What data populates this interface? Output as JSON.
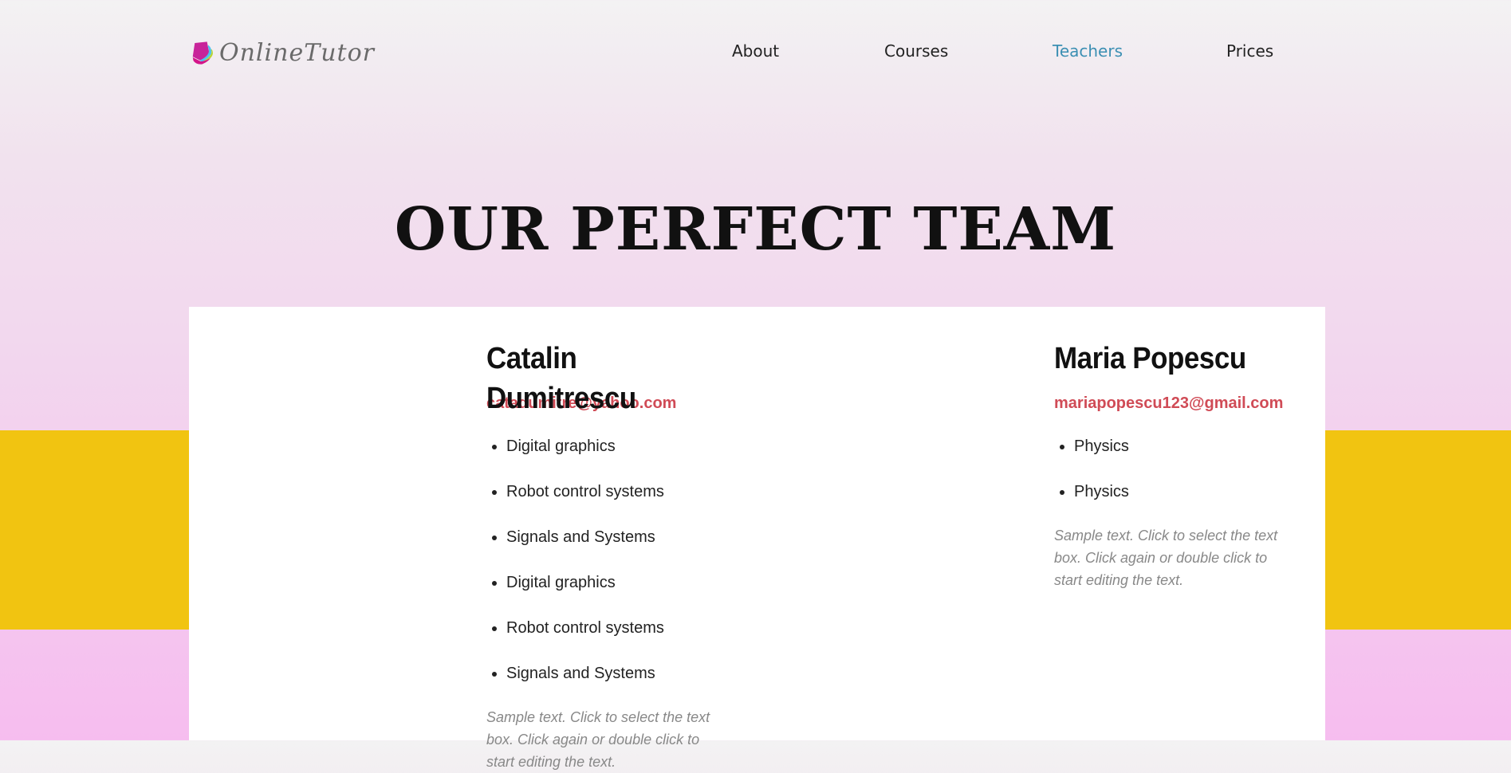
{
  "header": {
    "logo_text": "OnlineTutor",
    "logo_icon": "book-pages-icon",
    "nav": [
      {
        "label": "About",
        "active": false
      },
      {
        "label": "Courses",
        "active": false
      },
      {
        "label": "Teachers",
        "active": true
      },
      {
        "label": "Prices",
        "active": false
      }
    ]
  },
  "main": {
    "title": "OUR PERFECT TEAM",
    "teachers": [
      {
        "name": "Catalin Dumitrescu",
        "email": "catadumitre@yahoo.com",
        "subjects": [
          "Digital graphics",
          "Robot control systems",
          "Signals and Systems",
          "Digital graphics",
          "Robot control systems",
          "Signals and Systems"
        ],
        "sample_text": "Sample text. Click to select the text box. Click again or double click to start editing the text."
      },
      {
        "name": "Maria Popescu",
        "email": "mariapopescu123@gmail.com",
        "subjects": [
          "Physics",
          "Physics"
        ],
        "sample_text": "Sample text. Click to select the text box. Click again or double click to start editing the text."
      }
    ]
  },
  "colors": {
    "accent_link": "#3b8fb3",
    "email": "#d04b56",
    "band_yellow": "#f1c411",
    "band_pink": "#f6bdef"
  }
}
